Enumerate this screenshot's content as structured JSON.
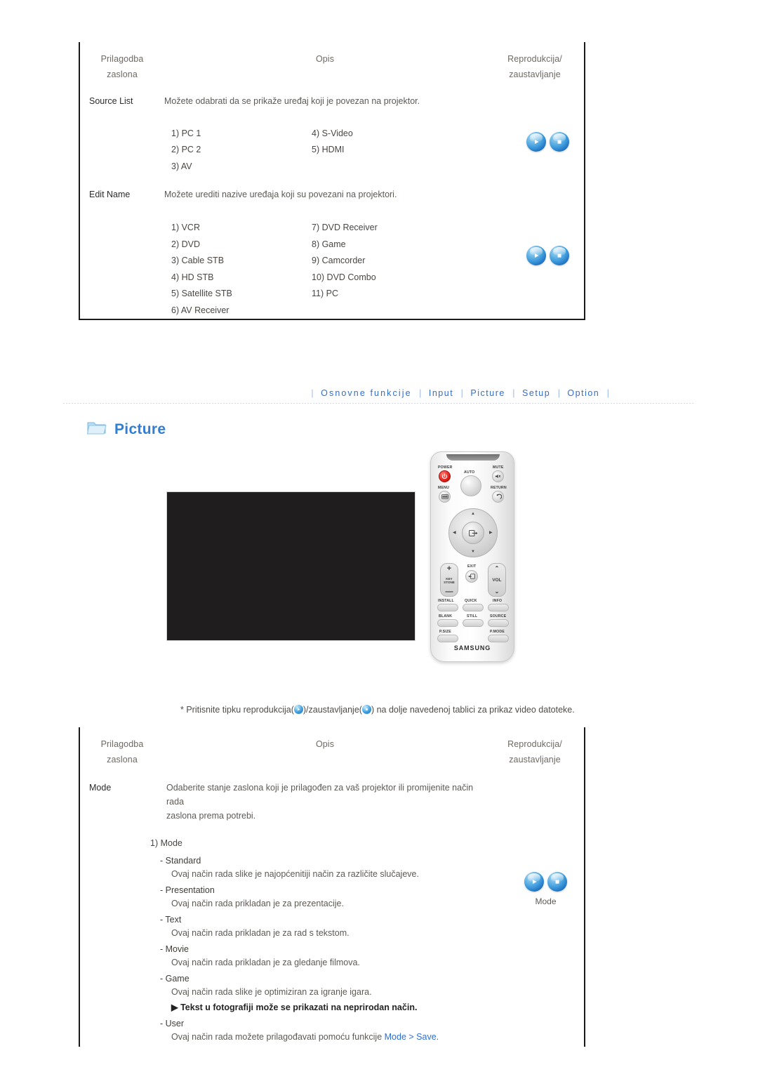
{
  "tables": {
    "header": {
      "col1_line1": "Prilagodba",
      "col1_line2": "zaslona",
      "col2": "Opis",
      "col3_line1": "Reprodukcija/",
      "col3_line2": "zaustavljanje"
    }
  },
  "input_table": {
    "rows": [
      {
        "label": "Source List",
        "desc": "Možete odabrati da se prikaže uređaj koji je povezan na projektor.",
        "options_col1": [
          "1) PC 1",
          "2) PC 2",
          "3) AV"
        ],
        "options_col2": [
          "4) S-Video",
          "5) HDMI"
        ]
      },
      {
        "label": "Edit Name",
        "desc": "Možete urediti nazive uređaja koji su povezani na projektori.",
        "options_col1": [
          "1) VCR",
          "2) DVD",
          "3) Cable STB",
          "4) HD STB",
          "5) Satellite STB",
          "6) AV Receiver"
        ],
        "options_col2": [
          "7) DVD Receiver",
          "8) Game",
          "9) Camcorder",
          "10) DVD Combo",
          "11) PC"
        ]
      }
    ]
  },
  "nav": {
    "items": [
      {
        "label": "Osnovne funkcije"
      },
      {
        "label": "Input"
      },
      {
        "label": "Picture"
      },
      {
        "label": "Setup"
      },
      {
        "label": "Option"
      }
    ],
    "separator": "|"
  },
  "section": {
    "title": "Picture",
    "icon": "folder-icon"
  },
  "remote": {
    "brand": "SAMSUNG",
    "buttons": [
      "POWER",
      "AUTO",
      "MUTE",
      "MENU",
      "RETURN",
      "EXIT",
      "VOL",
      "INSTALL",
      "QUICK",
      "INFO",
      "BLANK",
      "STILL",
      "SOURCE",
      "P.SIZE",
      "P.MODE"
    ],
    "labels": {
      "power": "POWER",
      "auto": "AUTO",
      "mute": "MUTE",
      "menu": "MENU",
      "return": "RETURN",
      "exit": "EXIT",
      "vol": "VOL",
      "install": "INSTALL",
      "quick": "QUICK",
      "info": "INFO",
      "blank": "BLANK",
      "still": "STILL",
      "source": "SOURCE",
      "psize": "P.SIZE",
      "pmode": "P.MODE"
    }
  },
  "note": {
    "part1": "* Pritisnite tipku reprodukcija(",
    "part2": ")/zaustavljanje(",
    "part3": ") na dolje navedenoj tablici za prikaz video datoteke."
  },
  "picture_table": {
    "row": {
      "label": "Mode",
      "desc_line1": "Odaberite stanje zaslona koji je prilagođen za vaš projektor ili promijenite način rada",
      "desc_line2": "zaslona prema potrebi.",
      "list_head": "1) Mode",
      "control_caption": "Mode",
      "items": [
        {
          "name": "- Standard",
          "desc": "Ovaj način rada slike je najopćenitiji način za različite slučajeve.",
          "tip": ""
        },
        {
          "name": "- Presentation",
          "desc": "Ovaj način rada prikladan je za prezentacije.",
          "tip": ""
        },
        {
          "name": "- Text",
          "desc": "Ovaj način rada prikladan je za rad s tekstom.",
          "tip": ""
        },
        {
          "name": "- Movie",
          "desc": "Ovaj način rada prikladan je za gledanje filmova.",
          "tip": ""
        },
        {
          "name": "- Game",
          "desc": "Ovaj način rada slike je optimiziran za igranje igara.",
          "tip": "▶ Tekst u fotografiji može se prikazati na neprirodan način."
        },
        {
          "name": "- User",
          "desc_pre": "Ovaj način rada možete prilagođavati pomoću funkcije ",
          "desc_link": "Mode > Save",
          "desc_post": ".",
          "tip": ""
        }
      ]
    }
  },
  "colors": {
    "accent_blue": "#2f6fd0",
    "heading_blue": "#2f7fd6",
    "screen_black": "#1f1d1d",
    "border_dark": "#1a1a1a"
  }
}
